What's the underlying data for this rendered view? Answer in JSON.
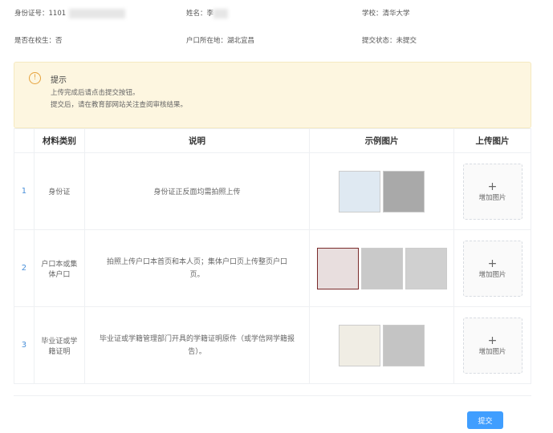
{
  "info": {
    "id_label": "身份证号：1101",
    "name_label": "姓名：李",
    "school": "学校：清华大学",
    "in_school": "是否在校生：否",
    "hukou": "户口所在地：湖北宜昌",
    "status": "提交状态：未提交"
  },
  "notice": {
    "icon": "warning-icon",
    "title": "提示",
    "lines": [
      "上传完成后请点击提交按钮。",
      "提交后，请在教育部网站关注查阅审核结果。"
    ]
  },
  "table": {
    "headers": [
      "",
      "材料类别",
      "说明",
      "示例图片",
      "上传图片"
    ],
    "rows": [
      {
        "index": "1",
        "category": "身份证",
        "desc": "身份证正反面均需拍照上传",
        "upload": "增加图片",
        "examples": 2
      },
      {
        "index": "2",
        "category": "户口本或集体户口",
        "desc": "拍照上传户口本首页和本人页；集体户口页上传整页户口页。",
        "upload": "增加图片",
        "examples": 3
      },
      {
        "index": "3",
        "category": "毕业证或学籍证明",
        "desc": "毕业证或学籍管理部门开具的学籍证明原件（或学信网学籍报告）。",
        "upload": "增加图片",
        "examples": 2
      }
    ]
  },
  "submit_label": "提交",
  "colors": {
    "accent": "#409eff",
    "warning": "#e6a23c",
    "notice_bg": "#fdf6e0"
  }
}
